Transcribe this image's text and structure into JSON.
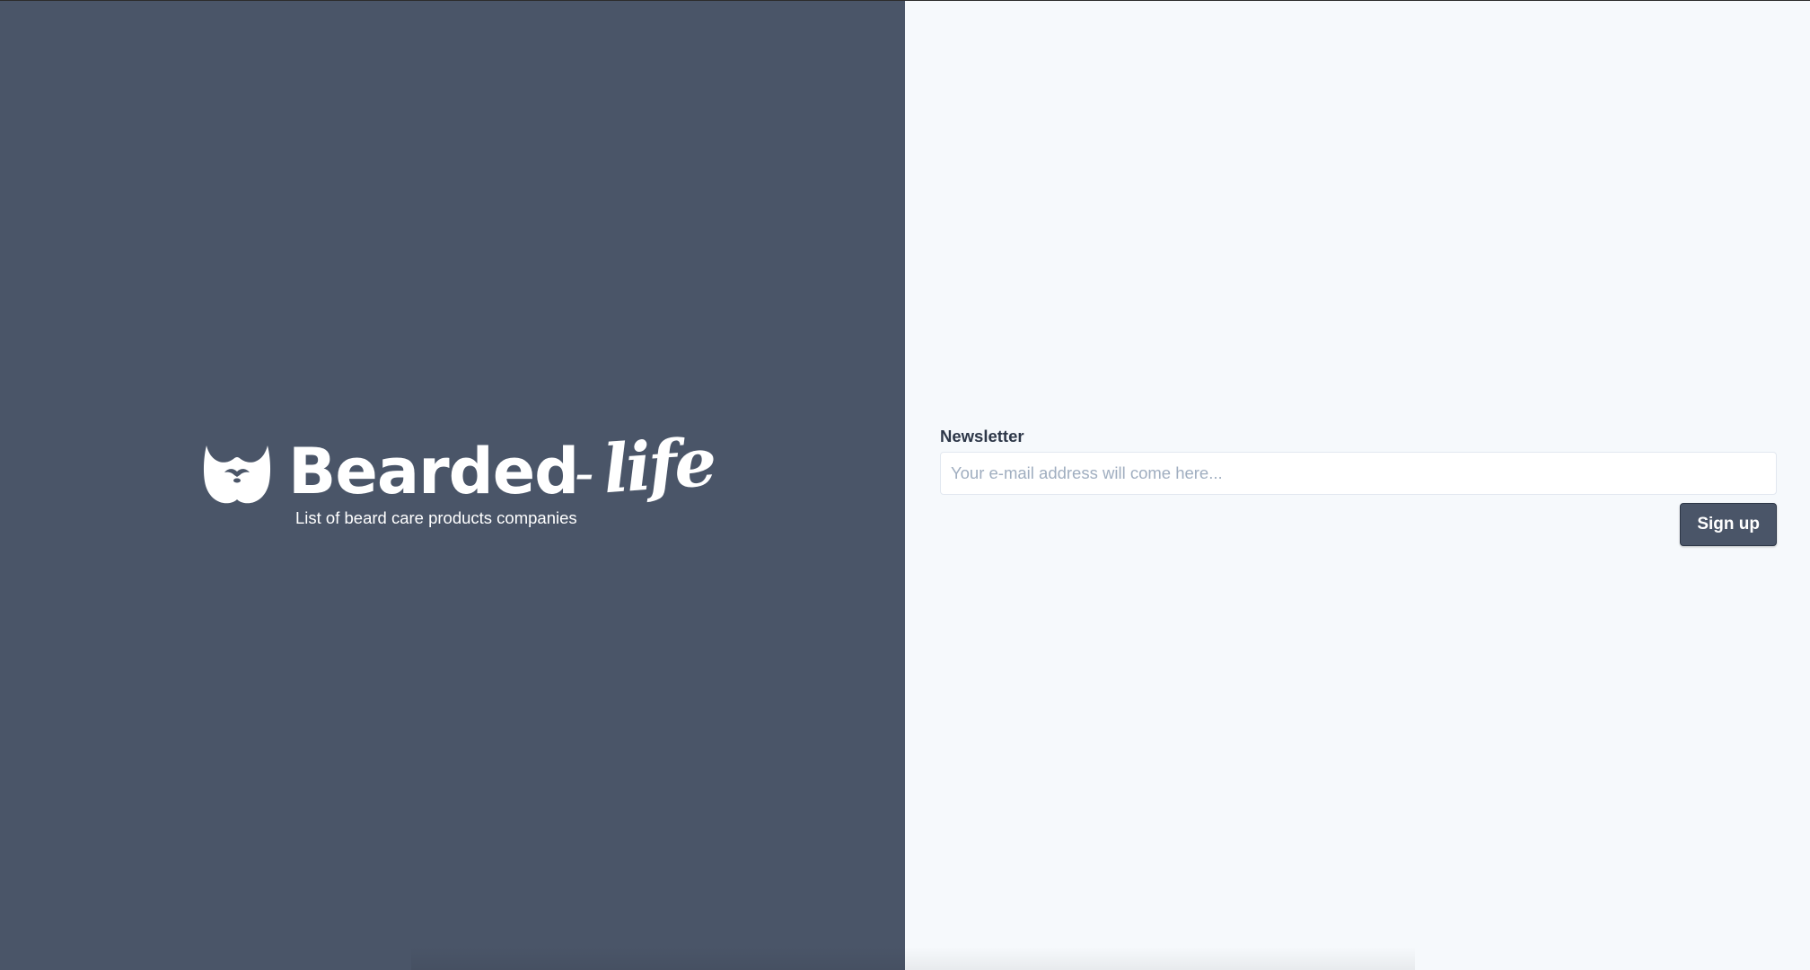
{
  "brand": {
    "logo_icon": "beard-icon",
    "name_main": "Bearded",
    "name_dash": "-",
    "name_script": "life",
    "tagline": "List of beard care products companies"
  },
  "newsletter": {
    "label": "Newsletter",
    "email_value": "",
    "email_placeholder": "Your e-mail address will come here...",
    "submit_label": "Sign up"
  },
  "colors": {
    "left_panel_bg": "#4a5568",
    "right_panel_bg": "#f6f9fc",
    "button_bg": "#4a5568",
    "label_text": "#2d3748",
    "placeholder_text": "#a0aec0"
  }
}
